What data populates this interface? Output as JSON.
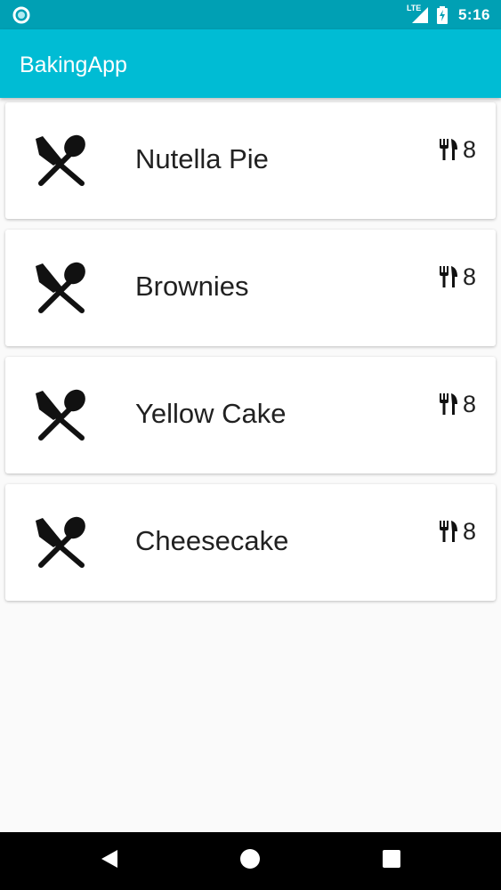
{
  "status_bar": {
    "time": "5:16",
    "network_label": "LTE",
    "bg_color": "#00a0b4"
  },
  "app_bar": {
    "title": "BakingApp",
    "bg_color": "#00bcd4"
  },
  "recipes": [
    {
      "name": "Nutella Pie",
      "servings": "8",
      "icon": "cutlery-icon"
    },
    {
      "name": "Brownies",
      "servings": "8",
      "icon": "cutlery-icon"
    },
    {
      "name": "Yellow Cake",
      "servings": "8",
      "icon": "cutlery-icon"
    },
    {
      "name": "Cheesecake",
      "servings": "8",
      "icon": "cutlery-icon"
    }
  ],
  "nav_bar": {
    "back": "back-icon",
    "home": "home-icon",
    "recents": "recents-icon"
  }
}
